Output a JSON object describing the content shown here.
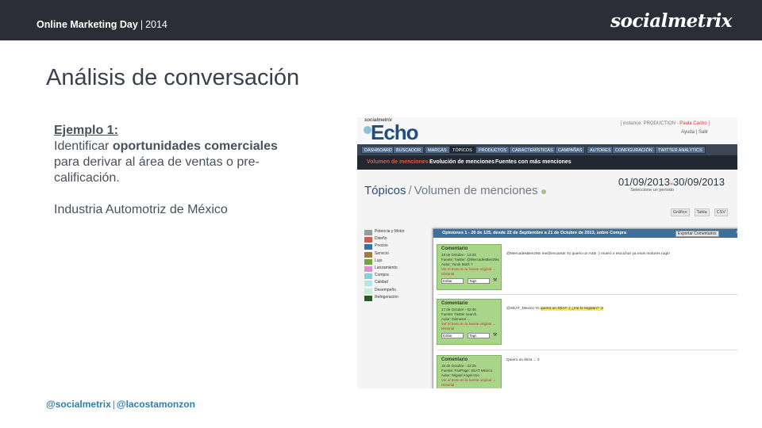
{
  "header": {
    "event": "Online Marketing Day",
    "separator": "|",
    "year": "2014",
    "brand": "socialmetrix"
  },
  "slide": {
    "title": "Análisis de conversación",
    "example_heading": "Ejemplo 1:",
    "line1_pre": "Identificar ",
    "line1_bold": "oportunidades comerciales",
    "line2": "para derivar al área de ventas o pre-calificación.",
    "industry": "Industria Automotriz de México"
  },
  "footer": {
    "handle1": "@socialmetrix",
    "separator": "|",
    "handle2": "@lacostamonzon"
  },
  "app": {
    "small_brand": "socialmetrix",
    "logo": "Echo",
    "instance_text": "[ instance: PRODUCTION - ",
    "instance_user": "Paula Cacho",
    "instance_end": " ]",
    "help_links": "Ayuda | Salir",
    "nav": [
      "DASHBOARD",
      "BUSCADOR",
      "MARCAS",
      "TÓPICOS",
      "PRODUCTOS",
      "CARACTERÍSTICAS",
      "CAMPAÑAS",
      "AUTORES",
      "CONFIGURACIÓN",
      "TWITTER ANALYTICS"
    ],
    "nav_active": "TÓPICOS",
    "subnav": [
      "Volumen de menciones",
      "Evolución de menciones",
      "Fuentes con más menciones"
    ],
    "subnav_active": "Volumen de menciones",
    "breadcrumb_main": "Tópicos",
    "breadcrumb_sep": "/",
    "breadcrumb_rest": "Volumen de menciones",
    "date_from": "01/09/2013",
    "date_arrow": "»",
    "date_to": "30/09/2013",
    "period_hint": "Seleccione un período",
    "tools": [
      "Gráfico",
      "Tabla",
      "CSV"
    ],
    "legend": [
      {
        "label": "Potencia y Motor",
        "color": "#9a9a9a"
      },
      {
        "label": "Diseño",
        "color": "#d9534f"
      },
      {
        "label": "Precios",
        "color": "#3e6fa3"
      },
      {
        "label": "Servicio",
        "color": "#a07b3c"
      },
      {
        "label": "Lujo",
        "color": "#6aaa3a"
      },
      {
        "label": "Lanzamiento",
        "color": "#d98fd9"
      },
      {
        "label": "Compra",
        "color": "#7ed1d6"
      },
      {
        "label": "Calidad",
        "color": "#b8e6e8"
      },
      {
        "label": "Desempeño",
        "color": "#c8ecd6"
      },
      {
        "label": "Refrigeración",
        "color": "#2d5a1f"
      }
    ]
  },
  "popup": {
    "title": "Opiniones 1 - 20 de 125, desde 22 de Septiembre a 21 de Octubre de 2013, sobre Compra",
    "export_label": "Exportar Comentarios",
    "close": "×",
    "cards": [
      {
        "title": "Comentario",
        "date": "18 de Octubre - 13:33",
        "source": "Fuente: Twitter: @MercadesBenzMx",
        "author": "Autor: Yoruk Mark ?",
        "link": "Ver el texto en la fuente original →",
        "history": "Historial",
        "edit": "Editar",
        "tags": "Tags",
        "message_pre": "@MercadesBenzMx me@encanta! Yo quiero un A45! :) mueró x escuchar ya esos motores rugir!",
        "message_hl": ""
      },
      {
        "title": "Comentario",
        "date": "17 de Octubre - 02:46",
        "source": "Fuente: Twitter search",
        "author": "Autor: Dámasu/ ...",
        "link": "Ver el texto en la fuente original →",
        "history": "Historial",
        "edit": "Editar",
        "tags": "Tags",
        "message_pre": "@SEAT_Mexico Yo ",
        "message_hl": "quiero un SEAT :( ¿me lo regalan? :3"
      },
      {
        "title": "Comentario",
        "date": "16 de Octubre - 23:25",
        "source": "Fuente: FanPage: SEAT México",
        "author": "Autor: Miguel Angel Imo",
        "link": "Ver el texto en la fuente original →",
        "history": "Historial",
        "edit": "",
        "tags": "",
        "message_pre": "Quiero un ibiza ... 3",
        "message_hl": ""
      }
    ]
  }
}
